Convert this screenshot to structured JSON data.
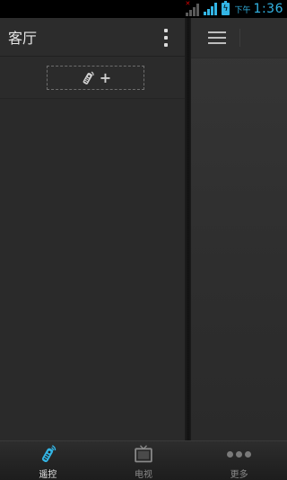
{
  "status_bar": {
    "ampm": "下午",
    "time": "1:36",
    "signal1_icon": "no-sim-signal-icon",
    "signal2_icon": "signal-icon",
    "battery_icon": "battery-charging-icon"
  },
  "left_panel": {
    "title": "客厅",
    "menu_icon": "overflow-menu-icon",
    "add_remote_icon": "add-remote-icon"
  },
  "right_panel": {
    "menu_icon": "hamburger-menu-icon"
  },
  "tabs": [
    {
      "label": "遥控",
      "icon": "remote-icon",
      "active": true
    },
    {
      "label": "电视",
      "icon": "tv-icon",
      "active": false
    },
    {
      "label": "更多",
      "icon": "more-icon",
      "active": false
    }
  ],
  "colors": {
    "accent": "#33b5e5",
    "inactive": "#8a8a8a"
  }
}
